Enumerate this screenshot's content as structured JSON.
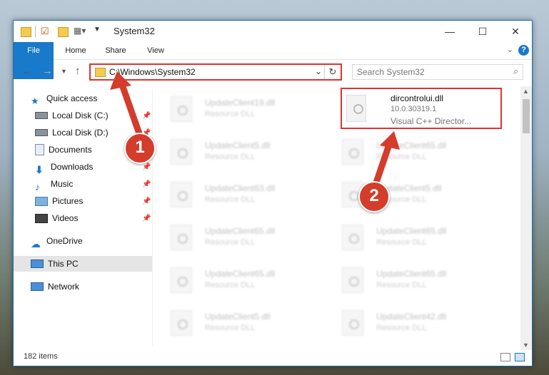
{
  "window": {
    "title": "System32"
  },
  "ribbon": {
    "tabs": [
      "File",
      "Home",
      "Share",
      "View"
    ]
  },
  "address": {
    "path": "C:\\Windows\\System32"
  },
  "search": {
    "placeholder": "Search System32"
  },
  "sidebar": {
    "items": [
      {
        "label": "Quick access",
        "icon": "star-icon",
        "pinned": false
      },
      {
        "label": "Local Disk (C:)",
        "icon": "drive-icon",
        "pinned": true
      },
      {
        "label": "Local Disk (D:)",
        "icon": "drive-icon",
        "pinned": true
      },
      {
        "label": "Documents",
        "icon": "documents-icon",
        "pinned": true
      },
      {
        "label": "Downloads",
        "icon": "download-icon",
        "pinned": true
      },
      {
        "label": "Music",
        "icon": "music-icon",
        "pinned": true
      },
      {
        "label": "Pictures",
        "icon": "pictures-icon",
        "pinned": true
      },
      {
        "label": "Videos",
        "icon": "videos-icon",
        "pinned": true
      },
      {
        "label": "OneDrive",
        "icon": "cloud-icon",
        "pinned": false
      },
      {
        "label": "This PC",
        "icon": "computer-icon",
        "pinned": false,
        "selected": true
      },
      {
        "label": "Network",
        "icon": "network-icon",
        "pinned": false
      }
    ]
  },
  "files": {
    "left": [
      {
        "name": "UpdateClient19.dll",
        "type": "Resource DLL"
      },
      {
        "name": "UpdateClient5.dll",
        "type": "Resource DLL"
      },
      {
        "name": "UpdateClient63.dll",
        "type": "Resource DLL"
      },
      {
        "name": "UpdateClient65.dll",
        "type": "Resource DLL"
      },
      {
        "name": "UpdateClient65.dll",
        "type": "Resource DLL"
      },
      {
        "name": "UpdateClient5.dll",
        "type": "Resource DLL"
      }
    ],
    "right": [
      {
        "name": "UpdateClient65.dll",
        "type": "Resource DLL"
      },
      {
        "name": "UpdateClient5.dll",
        "type": "Resource DLL"
      },
      {
        "name": "UpdateClient65.dll",
        "type": "Resource DLL"
      },
      {
        "name": "UpdateClient65.dll",
        "type": "Resource DLL"
      },
      {
        "name": "UpdateClient42.dll",
        "type": "Resource DLL"
      }
    ],
    "highlighted": {
      "name": "dircontrolui.dll",
      "version": "10.0.30319.1",
      "description": "Visual C++ Director..."
    }
  },
  "status": {
    "item_count": "182 items"
  },
  "annotations": {
    "badge1": "1",
    "badge2": "2",
    "color": "#d43c2b"
  }
}
